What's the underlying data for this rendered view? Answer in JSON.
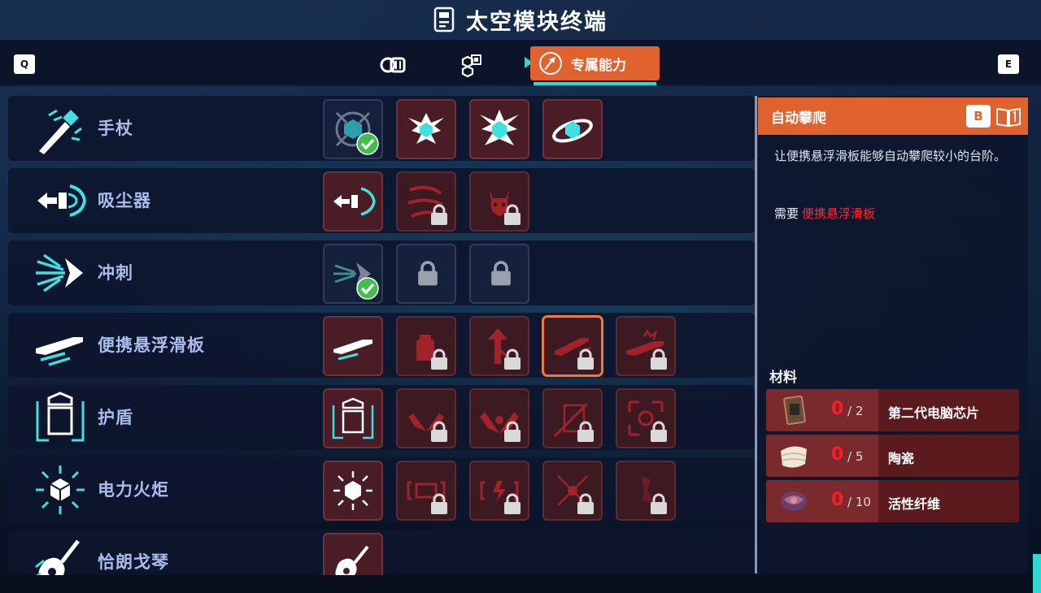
{
  "title": "太空模块终端",
  "keys": {
    "left": "Q",
    "right": "E",
    "panel": "B"
  },
  "tabs": [
    {
      "icon": "modules-icon",
      "label": ""
    },
    {
      "icon": "chip-icon",
      "label": ""
    },
    {
      "icon": "exclusive-ability-icon",
      "label": "专属能力",
      "active": true
    }
  ],
  "abilities": [
    {
      "label": "手杖",
      "icon": "wand-icon"
    },
    {
      "label": "吸尘器",
      "icon": "vacuum-icon"
    },
    {
      "label": "冲刺",
      "icon": "dash-icon"
    },
    {
      "label": "便携悬浮滑板",
      "icon": "hoverboard-icon"
    },
    {
      "label": "护盾",
      "icon": "shield-icon"
    },
    {
      "label": "电力火炬",
      "icon": "torch-icon"
    },
    {
      "label": "恰朗戈琴",
      "icon": "charango-icon"
    }
  ],
  "detail": {
    "name": "自动攀爬",
    "description": "让便携悬浮滑板能够自动攀爬较小的台阶。",
    "requires_label": "需要",
    "requires_item": "便携悬浮滑板",
    "materials_title": "材料",
    "materials": [
      {
        "have": "0",
        "need": "/ 2",
        "name": "第二代电脑芯片",
        "icon": "chip-item-icon"
      },
      {
        "have": "0",
        "need": "/ 5",
        "name": "陶瓷",
        "icon": "ceramic-item-icon"
      },
      {
        "have": "0",
        "need": "/ 10",
        "name": "活性纤维",
        "icon": "fiber-item-icon"
      }
    ]
  },
  "colors": {
    "accent": "#e0622e",
    "teal": "#30d8d0",
    "locked_bg": "#3d1a22",
    "alert": "#ff1a24"
  }
}
